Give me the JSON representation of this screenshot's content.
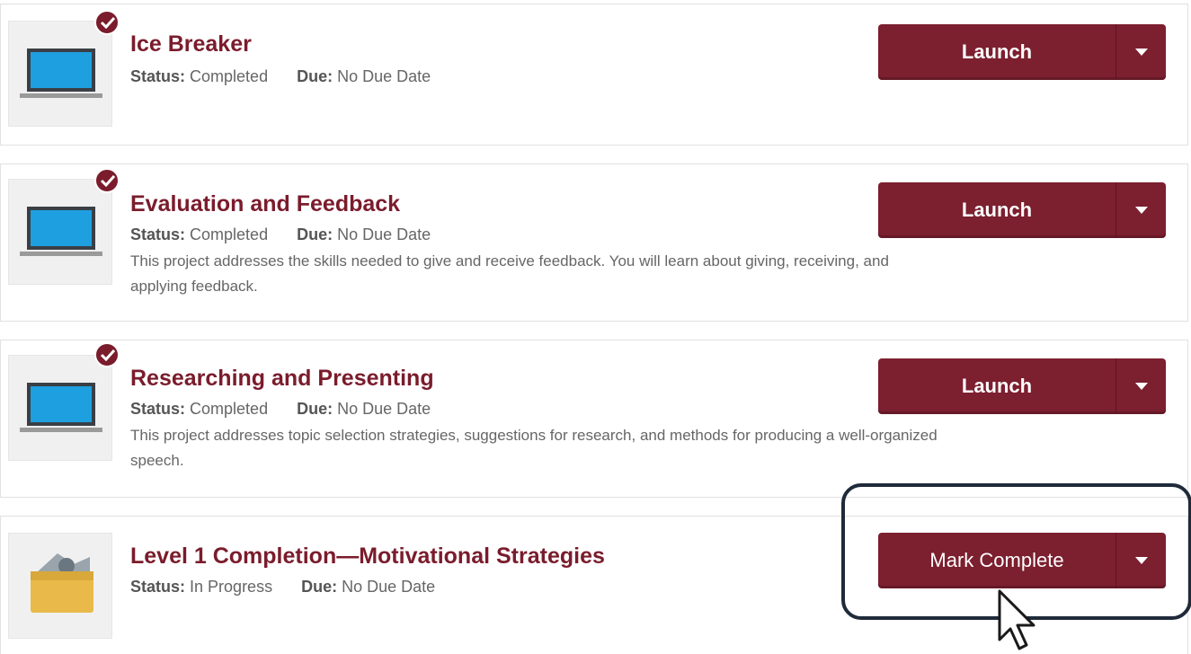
{
  "labels": {
    "status": "Status:",
    "due": "Due:"
  },
  "items": [
    {
      "title": "Ice Breaker",
      "status": "Completed",
      "due": "No Due Date",
      "description": "",
      "button": "Launch",
      "icon": "laptop-icon",
      "completed": true
    },
    {
      "title": "Evaluation and Feedback",
      "status": "Completed",
      "due": "No Due Date",
      "description": "This project addresses the skills needed to give and receive feedback. You will learn about giving, receiving, and applying feedback.",
      "button": "Launch",
      "icon": "laptop-icon",
      "completed": true
    },
    {
      "title": "Researching and Presenting",
      "status": "Completed",
      "due": "No Due Date",
      "description": "This project addresses topic selection strategies, suggestions for research, and methods for producing a well-organized speech.",
      "button": "Launch",
      "icon": "laptop-icon",
      "completed": true
    },
    {
      "title": "Level 1 Completion—Motivational Strategies",
      "status": "In Progress",
      "due": "No Due Date",
      "description": "",
      "button": "Mark Complete",
      "icon": "folder-icon",
      "completed": false
    }
  ],
  "colors": {
    "accent": "#7a1c2c",
    "button": "#7c1f2f",
    "highlight": "#1f2b3a"
  }
}
